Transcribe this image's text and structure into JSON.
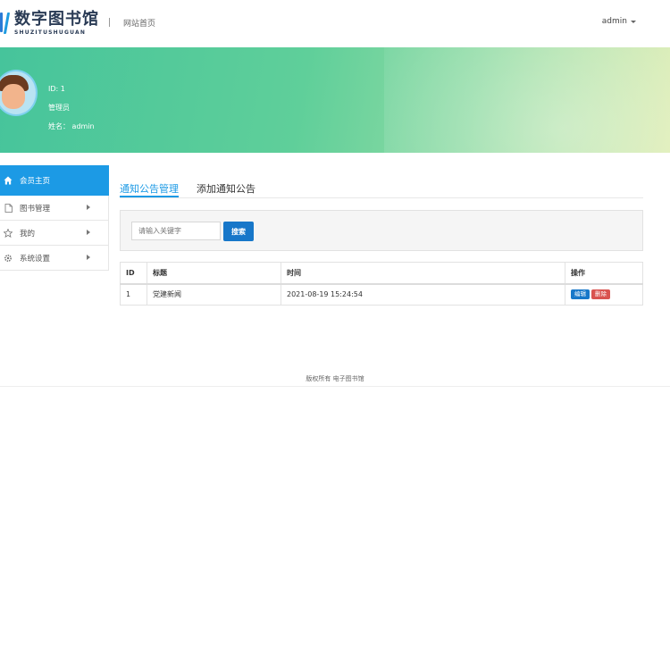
{
  "header": {
    "logo_title": "数字图书馆",
    "logo_subtitle": "SHUZITUSHUGUAN",
    "nav_home": "网站首页",
    "user_menu": "admin"
  },
  "profile": {
    "id_line": "ID: 1",
    "role": "管理员",
    "name_line": "姓名： admin"
  },
  "sidebar": {
    "items": [
      {
        "label": "会员主页",
        "icon": "home-icon"
      },
      {
        "label": "图书管理",
        "icon": "document-icon"
      },
      {
        "label": "我的",
        "icon": "star-icon"
      },
      {
        "label": "系统设置",
        "icon": "gear-icon"
      }
    ]
  },
  "tabs": [
    {
      "label": "通知公告管理"
    },
    {
      "label": "添加通知公告"
    }
  ],
  "search": {
    "placeholder": "请输入关键字",
    "button": "搜索"
  },
  "table": {
    "headers": [
      "ID",
      "标题",
      "时间",
      "操作"
    ],
    "rows": [
      {
        "id": "1",
        "title": "党建新闻",
        "time": "2021-08-19 15:24:54",
        "edit": "编辑",
        "delete": "删除"
      }
    ]
  },
  "footer": {
    "text": "版权所有 电子图书馆"
  },
  "colors": {
    "accent": "#1c9ae5",
    "primary_button": "#1777c9",
    "danger": "#d9534f",
    "banner_start": "#46c49b",
    "banner_end": "#dcecb0"
  }
}
